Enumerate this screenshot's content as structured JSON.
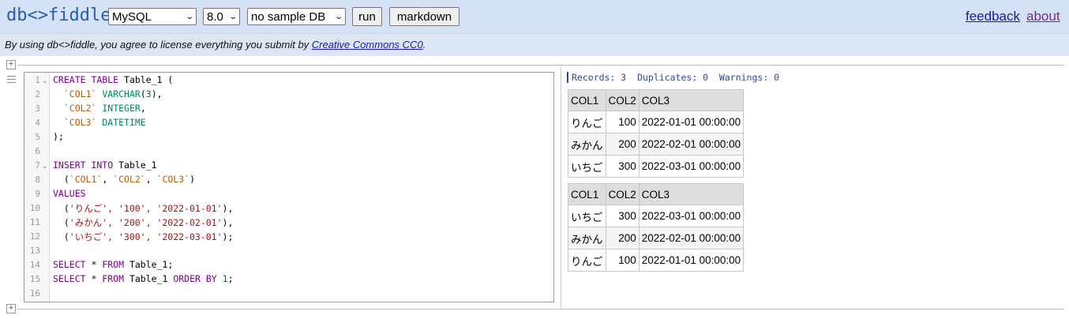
{
  "header": {
    "logo": "db<>fiddle",
    "db_engine": "MySQL",
    "version": "8.0",
    "sample_db": "no sample DB",
    "run_label": "run",
    "markdown_label": "markdown",
    "feedback_label": "feedback",
    "about_label": "about"
  },
  "license": {
    "text": "By using db<>fiddle, you agree to license everything you submit by ",
    "link": "Creative Commons CC0",
    "suffix": "."
  },
  "editor": {
    "line_numbers": [
      "1",
      "2",
      "3",
      "4",
      "5",
      "6",
      "7",
      "8",
      "9",
      "10",
      "11",
      "12",
      "13",
      "14",
      "15",
      "16"
    ]
  },
  "results": {
    "stats": "Records: 3  Duplicates: 0  Warnings: 0",
    "table1": {
      "headers": [
        "COL1",
        "COL2",
        "COL3"
      ],
      "rows": [
        [
          "りんご",
          "100",
          "2022-01-01 00:00:00"
        ],
        [
          "みかん",
          "200",
          "2022-02-01 00:00:00"
        ],
        [
          "いちご",
          "300",
          "2022-03-01 00:00:00"
        ]
      ]
    },
    "table2": {
      "headers": [
        "COL1",
        "COL2",
        "COL3"
      ],
      "rows": [
        [
          "いちご",
          "300",
          "2022-03-01 00:00:00"
        ],
        [
          "みかん",
          "200",
          "2022-02-01 00:00:00"
        ],
        [
          "りんご",
          "100",
          "2022-01-01 00:00:00"
        ]
      ]
    }
  },
  "colors": {
    "header_bg": "#d5e2f5",
    "license_bg": "#dde6f3",
    "logo": "#2a5bb0",
    "keyword": "#770088",
    "type": "#008855",
    "identifier": "#c05a00",
    "string": "#aa1111"
  }
}
